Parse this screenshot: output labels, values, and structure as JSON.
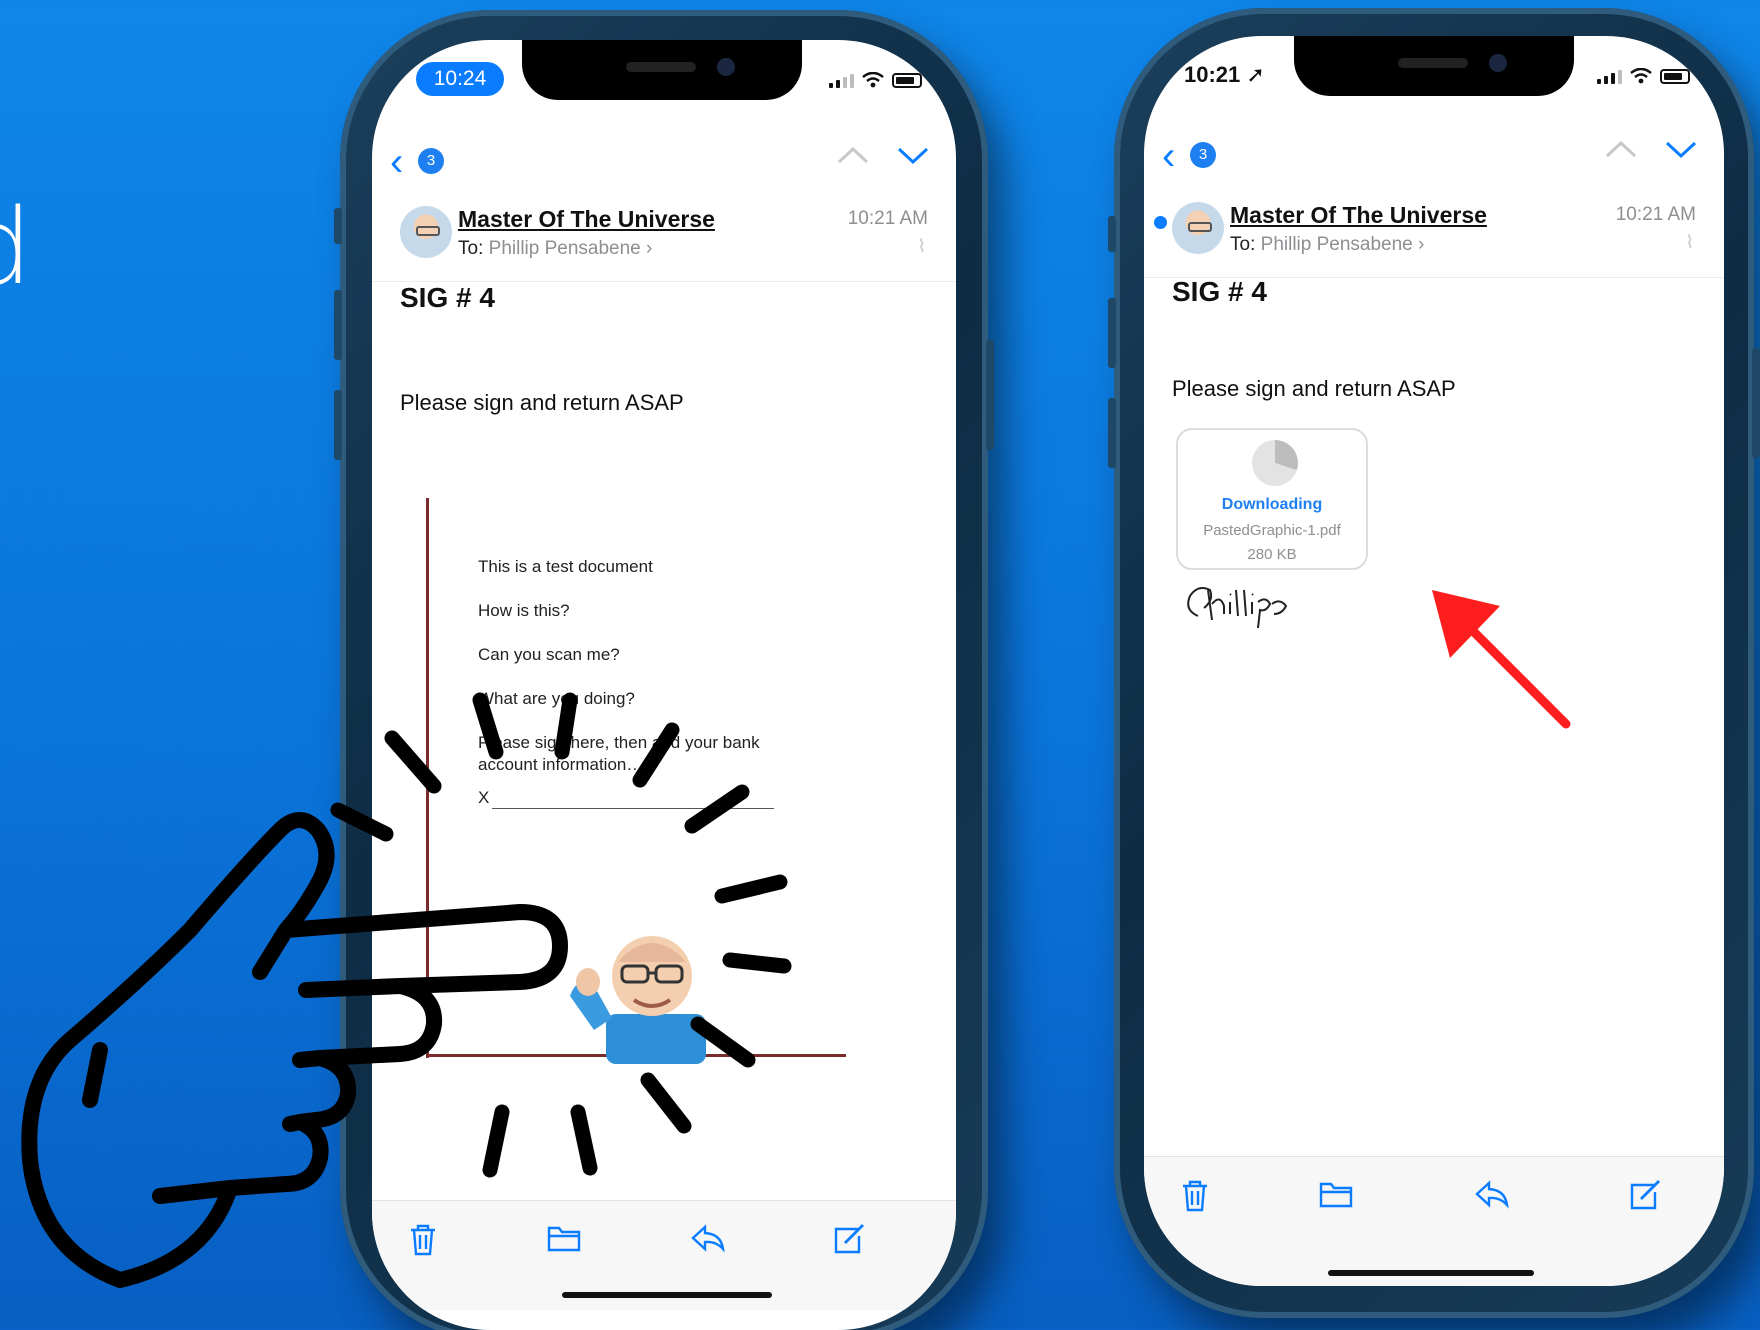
{
  "background": {
    "edge_letter": "d",
    "color": "#0a78e0"
  },
  "left_phone": {
    "status": {
      "time": "10:24"
    },
    "nav": {
      "badge_count": "3"
    },
    "email": {
      "sender": "Master Of The Universe",
      "to_label": "To:",
      "to_name": "Phillip Pensabene",
      "time": "10:21 AM",
      "subject": "SIG # 4",
      "body": "Please sign and return ASAP"
    },
    "document": {
      "lines": [
        "This is a test document",
        "How is this?",
        "Can you scan me?",
        "What are you doing?",
        "Please sign here, then add your bank account information…"
      ],
      "sign_mark": "X"
    },
    "toolbar": [
      "trash-icon",
      "folder-icon",
      "reply-icon",
      "compose-icon"
    ]
  },
  "right_phone": {
    "status": {
      "time": "10:21"
    },
    "nav": {
      "badge_count": "3"
    },
    "email": {
      "sender": "Master Of The Universe",
      "to_label": "To:",
      "to_name": "Phillip Pensabene",
      "time": "10:21 AM",
      "subject": "SIG # 4",
      "body": "Please sign and return ASAP"
    },
    "attachment": {
      "status": "Downloading",
      "filename": "PastedGraphic-1.pdf",
      "size": "280 KB"
    },
    "signature_text": "Phillip",
    "toolbar": [
      "trash-icon",
      "folder-icon",
      "reply-icon",
      "compose-icon"
    ]
  },
  "annotations": {
    "arrow_color": "#ff1e1e",
    "hand": "pointing-hand-icon"
  }
}
